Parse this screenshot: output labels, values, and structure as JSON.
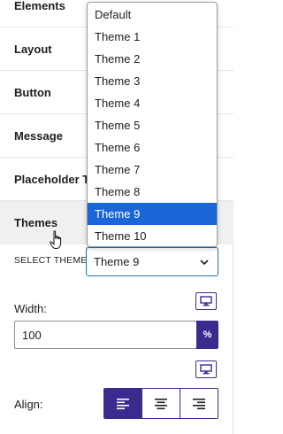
{
  "sections": [
    {
      "label": "Elements"
    },
    {
      "label": "Layout"
    },
    {
      "label": "Button"
    },
    {
      "label": "Message"
    },
    {
      "label": "Placeholder Te"
    },
    {
      "label": "Themes"
    }
  ],
  "theme_select": {
    "label": "SELECT THEME",
    "value": "Theme 9",
    "options": [
      "Default",
      "Theme 1",
      "Theme 2",
      "Theme 3",
      "Theme 4",
      "Theme 5",
      "Theme 6",
      "Theme 7",
      "Theme 8",
      "Theme 9",
      "Theme 10"
    ],
    "highlighted": "Theme 9"
  },
  "width": {
    "label": "Width:",
    "value": "100",
    "unit": "%"
  },
  "align": {
    "label": "Align:",
    "options": [
      "left",
      "center",
      "right"
    ],
    "selected": "left"
  },
  "icons": {
    "device": "desktop-icon",
    "dropdown": "chevron-down-icon",
    "cursor": "hand-pointer-icon"
  },
  "colors": {
    "accent": "#3c2a8e",
    "focus_border": "#2271b1",
    "option_highlight": "#1a66d8",
    "active_row_bg": "#f0f0f0"
  }
}
